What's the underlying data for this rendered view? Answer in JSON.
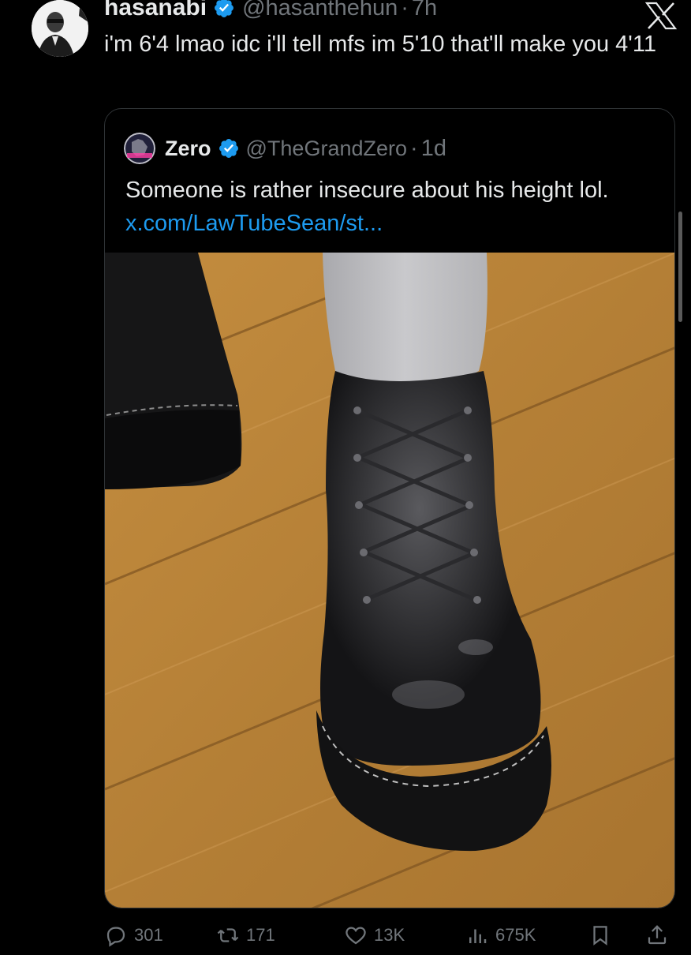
{
  "tweet": {
    "display_name": "hasanabi",
    "handle": "@hasanthehun",
    "separator": "·",
    "time": "7h",
    "text": "i'm 6'4 lmao idc i'll tell mfs im 5'10 that'll make you 4'11"
  },
  "quoted": {
    "display_name": "Zero",
    "handle": "@TheGrandZero",
    "separator": "·",
    "time": "1d",
    "text": "Someone is rather insecure about his height lol.",
    "link": "x.com/LawTubeSean/st..."
  },
  "actions": {
    "replies": "301",
    "reposts": "171",
    "likes": "13K",
    "views": "675K"
  },
  "colors": {
    "background": "#000000",
    "text": "#e7e9ea",
    "muted": "#71767b",
    "link": "#1d9bf0",
    "verified": "#1d9bf0",
    "border": "#2f3336"
  },
  "icons": [
    "verified-badge-icon",
    "x-logo-icon",
    "reply-icon",
    "repost-icon",
    "like-icon",
    "views-icon",
    "bookmark-icon",
    "share-icon"
  ]
}
